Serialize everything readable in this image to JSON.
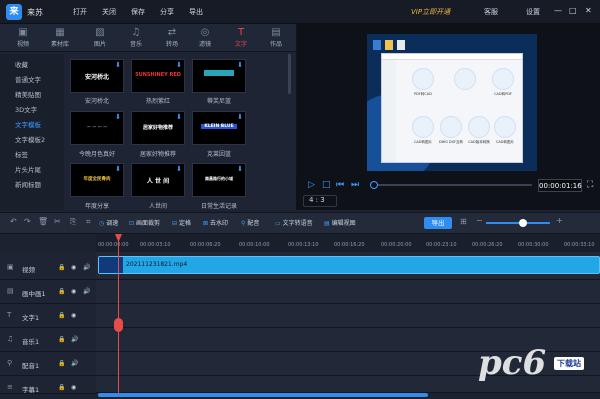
{
  "app": {
    "name": "来苏",
    "logo_icon": "app-logo-icon"
  },
  "menu": [
    "打开",
    "关闭",
    "保存",
    "分享",
    "导出"
  ],
  "vip_label": "VIP立即开通",
  "title_controls": [
    "客服",
    "设置",
    "—",
    "□",
    "✕"
  ],
  "tabs": [
    {
      "label": "视频",
      "icon": "video-icon"
    },
    {
      "label": "素材库",
      "icon": "library-icon"
    },
    {
      "label": "图片",
      "icon": "image-icon"
    },
    {
      "label": "音乐",
      "icon": "music-icon"
    },
    {
      "label": "转场",
      "icon": "transition-icon"
    },
    {
      "label": "滤镜",
      "icon": "filter-icon"
    },
    {
      "label": "文字",
      "icon": "text-icon"
    },
    {
      "label": "作品",
      "icon": "works-icon"
    }
  ],
  "categories": [
    "收藏",
    "普通文字",
    "精美贴图",
    "3D文字",
    "文字模板",
    "文字模板2",
    "标签",
    "片头片尾",
    "新闻标题"
  ],
  "templates": [
    {
      "text": "安河桥北",
      "caption": "安河桥北"
    },
    {
      "text": "SUNSHINEY RED",
      "caption": "热烈紫红"
    },
    {
      "text": "",
      "caption": "蒂芙尼蓝"
    },
    {
      "text": "",
      "caption": "今晚月色真好"
    },
    {
      "text": "居家好物推荐",
      "caption": "居家好物推荐"
    },
    {
      "text": "KLEIN BLUE",
      "caption": "克莱因蓝"
    },
    {
      "text": "年度全民骨肉",
      "caption": "年度分享"
    },
    {
      "text": "人 世 间",
      "caption": "人世间"
    },
    {
      "text": "南昌路行的小城",
      "caption": "日常生活记录"
    }
  ],
  "preview": {
    "screenshot_items": [
      "PDF转CAD",
      "CAD转PDF",
      "CAD转图片",
      "DWG DXF互转",
      "CAD版本转换",
      "CAD转图片",
      "CAD转DXF"
    ],
    "time": "00:00:01:16",
    "ratio": "4 : 3"
  },
  "tools": [
    "调速",
    "画面裁剪",
    "定格",
    "去水印",
    "配音",
    "文字转语音",
    "编辑视图"
  ],
  "export_label": "导出",
  "ruler": [
    "00:00:00:00",
    "00:00:03:10",
    "00:00:06:20",
    "00:00:10:00",
    "00:00:13:10",
    "00:00:16:20",
    "00:00:20:00",
    "00:00:23:10",
    "00:00:26:20",
    "00:00:30:00",
    "00:00:33:10"
  ],
  "tracks": [
    "视频",
    "画中画1",
    "文字1",
    "音乐1",
    "配音1",
    "字幕1"
  ],
  "clip_name": "202111231821.mp4",
  "watermark": {
    "logo": "pc6",
    "tag": "下载站"
  }
}
